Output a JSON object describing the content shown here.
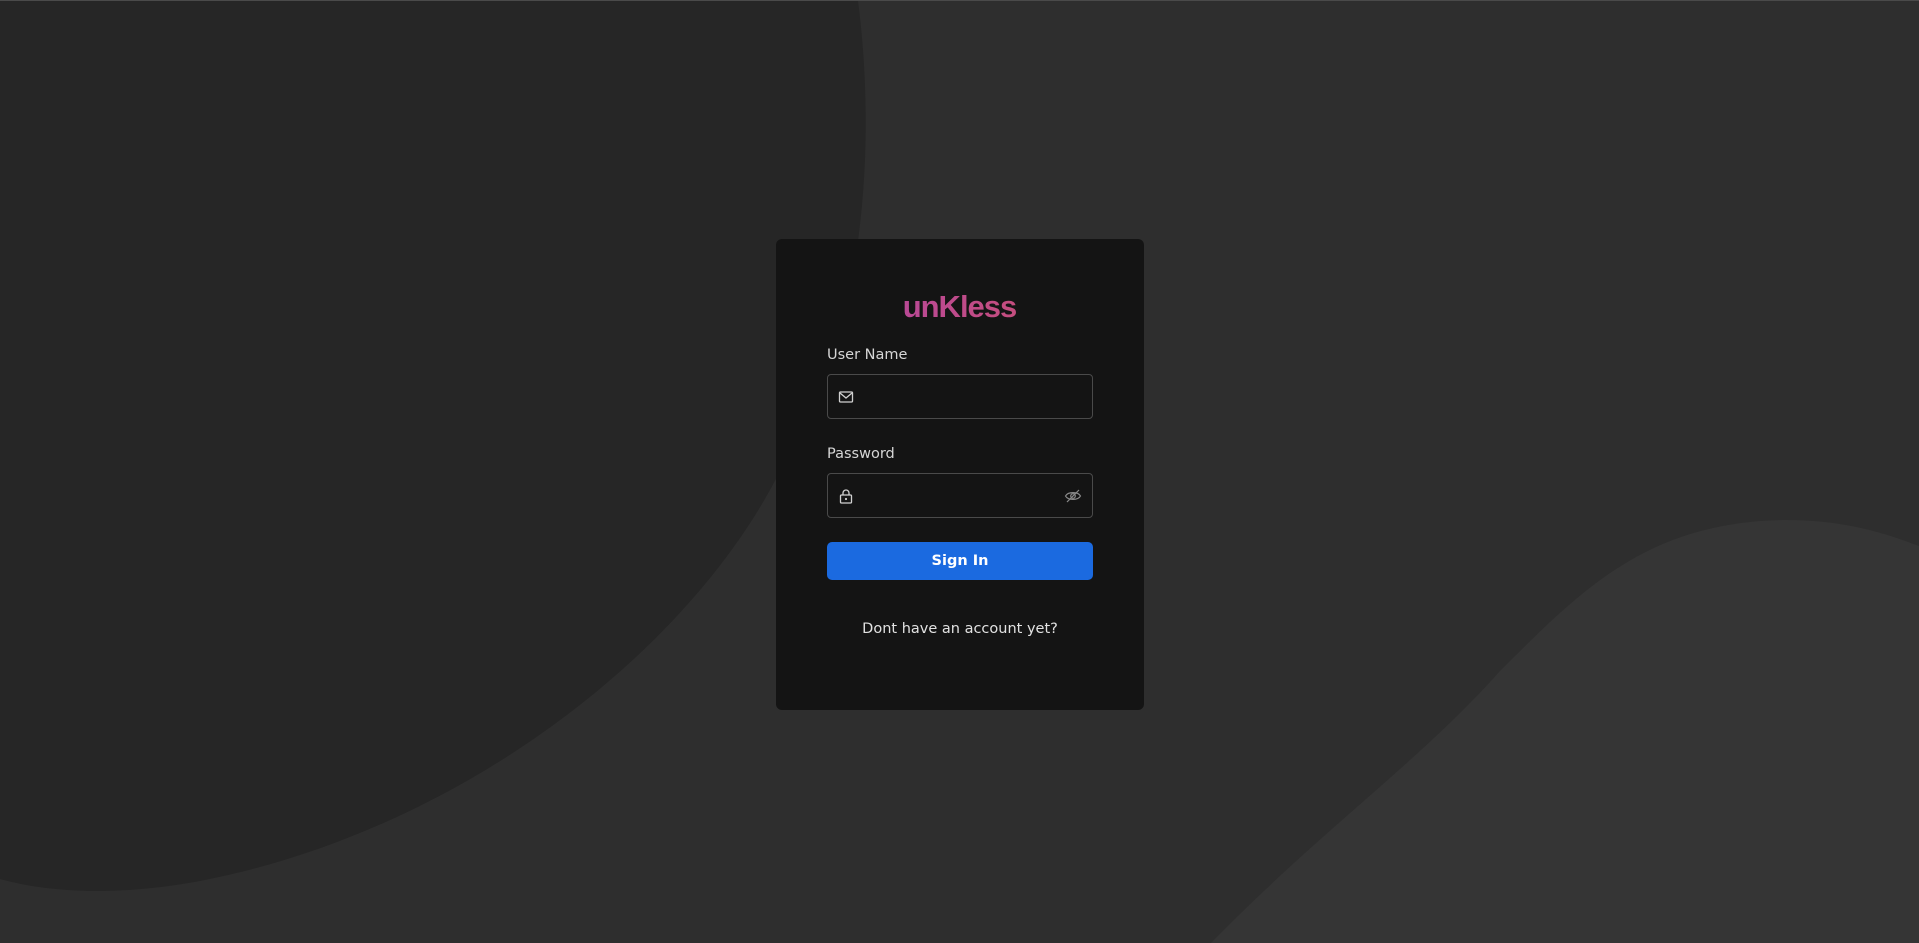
{
  "brand": {
    "logo_text": "unKless",
    "gradient_colors": [
      "#5b57c8",
      "#b5479d",
      "#e55c3e",
      "#f4a31c"
    ]
  },
  "form": {
    "username": {
      "label": "User Name",
      "value": "",
      "icon": "mail-icon"
    },
    "password": {
      "label": "Password",
      "value": "",
      "icon": "lock-icon",
      "toggle_icon": "eye-off-icon"
    },
    "submit_label": "Sign In",
    "signup_link": "Dont have an account yet?"
  },
  "colors": {
    "background": "#2e2e2e",
    "card": "#141414",
    "primary_button": "#1b6ae0"
  }
}
